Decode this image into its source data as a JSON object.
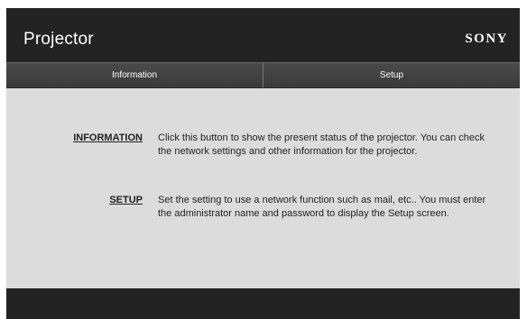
{
  "header": {
    "title": "Projector",
    "brand": "SONY"
  },
  "tabs": [
    {
      "label": "Information"
    },
    {
      "label": "Setup"
    }
  ],
  "main": {
    "rows": [
      {
        "link": "INFORMATION",
        "description": "Click this button to show the present status of the projector. You can check the network settings and other information for the projector."
      },
      {
        "link": "SETUP",
        "description": "Set the setting to use a network function such as mail, etc.. You must enter the administrator name and password to display the Setup screen."
      }
    ]
  },
  "colors": {
    "header_bg": "#232323",
    "tabbar_bg": "#3f3f3f",
    "content_bg": "#dcdcdc",
    "text": "#222222"
  }
}
